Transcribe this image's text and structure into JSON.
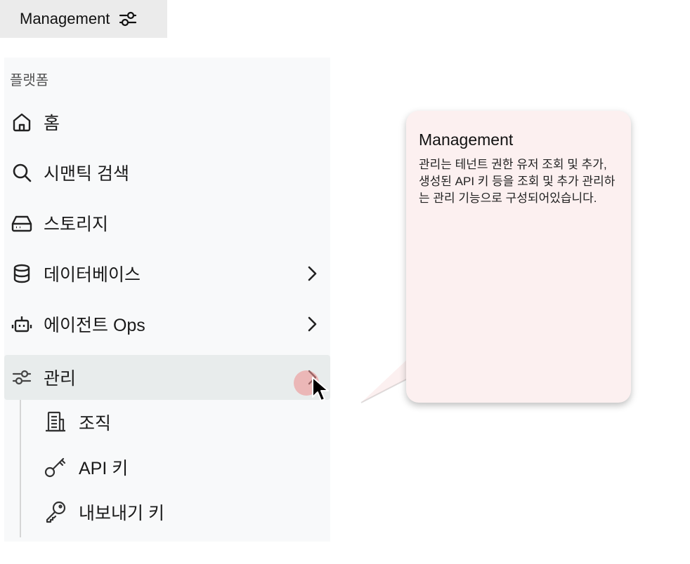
{
  "header": {
    "chip_label": "Management",
    "chip_icon": "sliders-icon"
  },
  "sidebar": {
    "section_title": "플랫폼",
    "items": [
      {
        "label": "홈",
        "icon": "home-icon",
        "has_chevron": false
      },
      {
        "label": "시맨틱 검색",
        "icon": "search-icon",
        "has_chevron": false
      },
      {
        "label": "스토리지",
        "icon": "storage-icon",
        "has_chevron": false
      },
      {
        "label": "데이터베이스",
        "icon": "database-icon",
        "has_chevron": true
      },
      {
        "label": "에이전트 Ops",
        "icon": "robot-icon",
        "has_chevron": true
      },
      {
        "label": "관리",
        "icon": "sliders-icon",
        "has_chevron": true,
        "active": true
      }
    ],
    "sub_items": [
      {
        "label": "조직",
        "icon": "building-icon"
      },
      {
        "label": "API 키",
        "icon": "key-icon"
      },
      {
        "label": "내보내기 키",
        "icon": "export-key-icon"
      }
    ]
  },
  "tooltip": {
    "title": "Management",
    "body": "관리는 테넌트 권한 유저 조회 및 추가, 생성된 API 키 등을 조회 및 추가 관리하는 관리 기능으로 구성되어있습니다."
  },
  "colors": {
    "active_bg": "#e8ecec",
    "tooltip_bg": "#fcf0f0",
    "hover_dot": "#f07878"
  }
}
